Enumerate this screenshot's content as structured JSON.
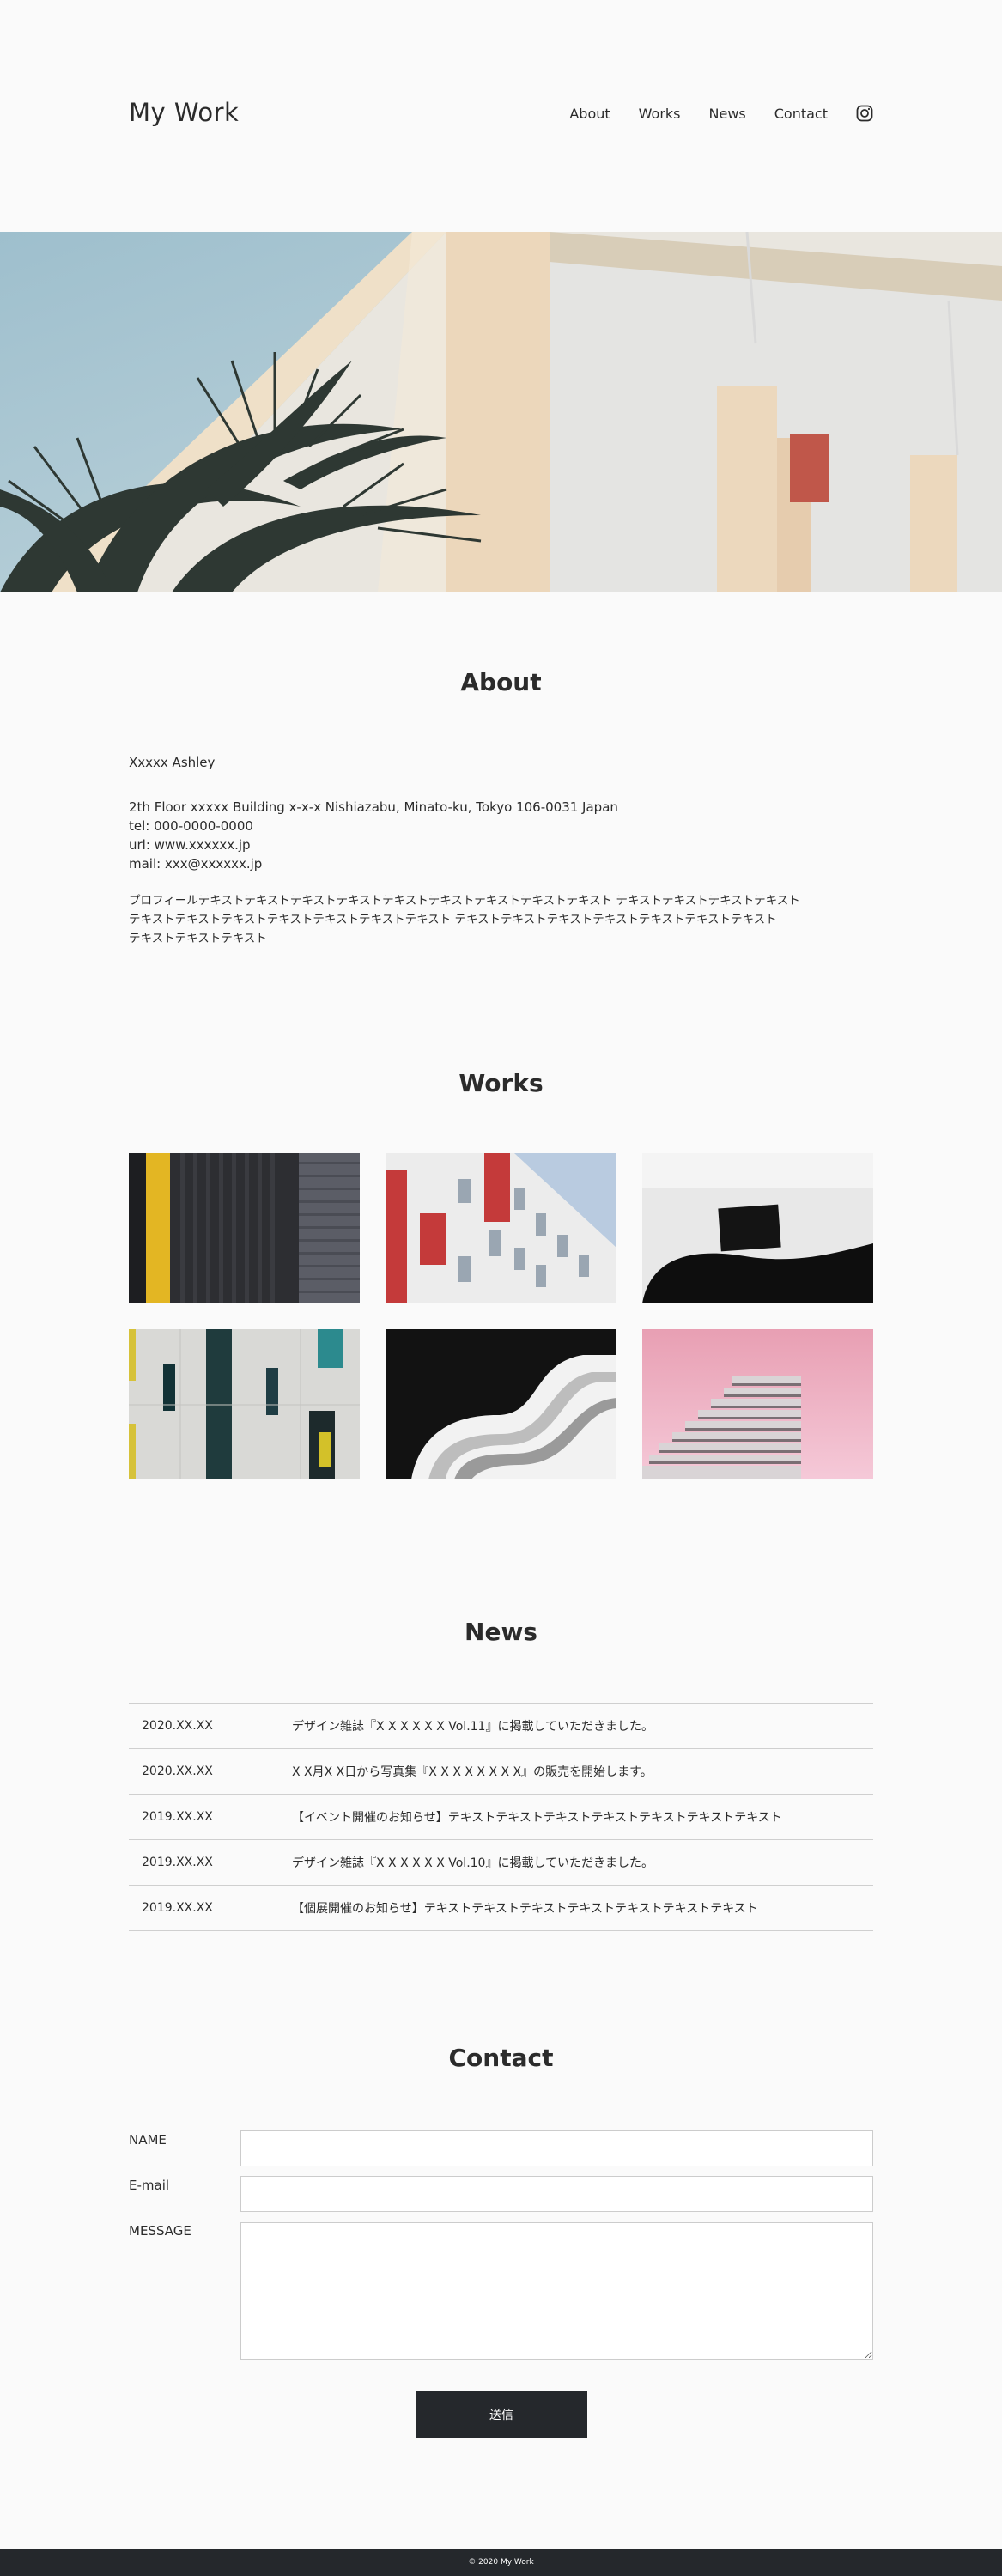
{
  "header": {
    "logo": "My Work",
    "nav": [
      "About",
      "Works",
      "News",
      "Contact"
    ],
    "social_icon": "instagram-icon"
  },
  "hero": {
    "image": "building-with-palm-leaves-photo"
  },
  "about": {
    "title": "About",
    "name": "Xxxxx Ashley",
    "address": "2th Floor xxxxx Building x-x-x Nishiazabu, Minato-ku, Tokyo 106-0031 Japan",
    "tel": "tel: 000-0000-0000",
    "url": "url: www.xxxxxx.jp",
    "mail": "mail: xxx@xxxxxx.jp",
    "profile_line1": "プロフィールテキストテキストテキストテキストテキストテキストテキストテキストテキスト テキストテキストテキストテキスト",
    "profile_line2": "テキストテキストテキストテキストテキストテキストテキスト テキストテキストテキストテキストテキストテキストテキスト",
    "profile_line3": "テキストテキストテキスト"
  },
  "works": {
    "title": "Works",
    "items": [
      "black-and-yellow-facade-photo",
      "white-and-red-building-photo",
      "black-chair-and-frame-photo",
      "grey-facade-colored-windows-photo",
      "curved-white-building-photo",
      "pink-stepped-building-photo"
    ]
  },
  "news": {
    "title": "News",
    "items": [
      {
        "date": "2020.XX.XX",
        "text": "デザイン雑誌『X X X X X X Vol.11』に掲載していただきました。"
      },
      {
        "date": "2020.XX.XX",
        "text": "X X月X X日から写真集『X X X X X X X X』の販売を開始します。"
      },
      {
        "date": "2019.XX.XX",
        "text": "【イベント開催のお知らせ】テキストテキストテキストテキストテキストテキストテキスト"
      },
      {
        "date": "2019.XX.XX",
        "text": "デザイン雑誌『X X X X X X Vol.10』に掲載していただきました。"
      },
      {
        "date": "2019.XX.XX",
        "text": "【個展開催のお知らせ】テキストテキストテキストテキストテキストテキストテキスト"
      }
    ]
  },
  "contact": {
    "title": "Contact",
    "name_label": "NAME",
    "email_label": "E-mail",
    "message_label": "MESSAGE",
    "name_value": "",
    "email_value": "",
    "message_value": "",
    "submit_label": "送信"
  },
  "footer": {
    "copyright": "© 2020 My Work"
  },
  "colors": {
    "background": "#fafafa",
    "text": "#2b2b2b",
    "button": "#25282c",
    "footer": "#25282c",
    "border": "#cfcfcf"
  }
}
